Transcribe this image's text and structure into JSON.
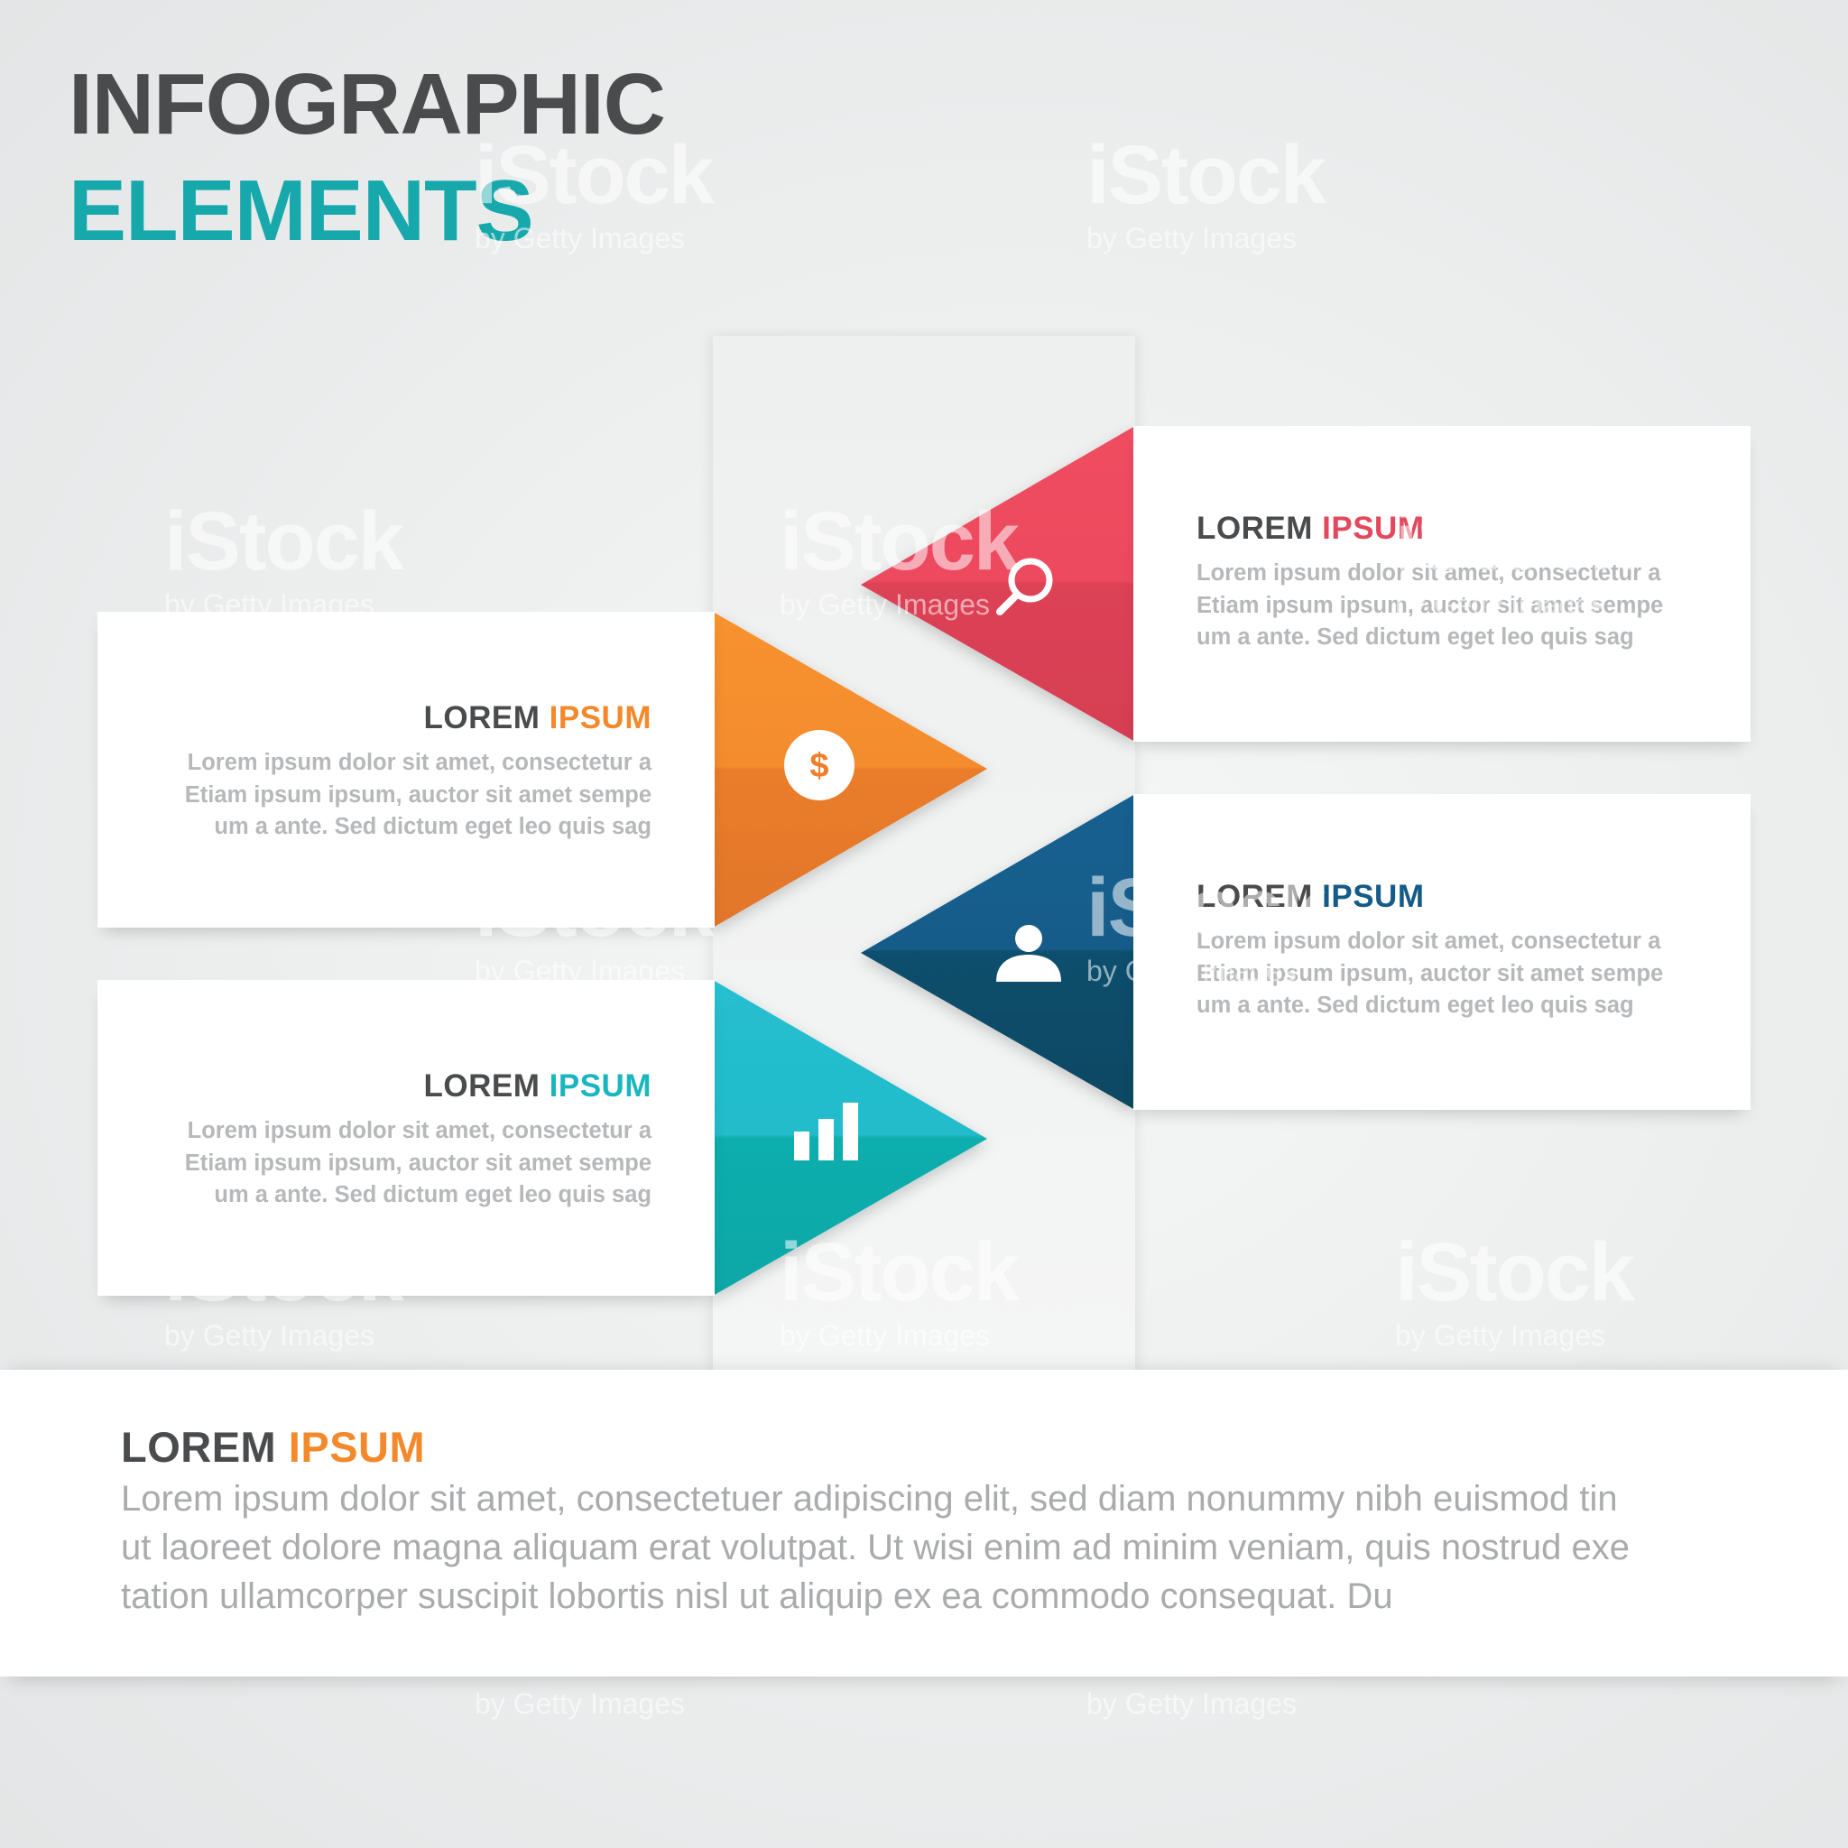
{
  "header": {
    "title_line1": "INFOGRAPHIC",
    "title_line2": "ELEMENTS",
    "title_accent_color": "#17a8ac"
  },
  "steps": [
    {
      "id": "red",
      "color": "#e4485c",
      "icon": "magnifier-icon",
      "title_dark": "LOREM",
      "title_accent": "IPSUM",
      "text": "Lorem ipsum dolor sit amet, consectetur a\nEtiam ipsum ipsum, auctor sit amet sempe\num a ante. Sed dictum eget leo quis sag"
    },
    {
      "id": "orange",
      "color": "#f3892b",
      "icon": "dollar-coin-icon",
      "title_dark": "LOREM",
      "title_accent": "IPSUM",
      "text": "Lorem ipsum dolor sit amet, consectetur a\nEtiam ipsum ipsum, auctor sit amet sempe\num a ante. Sed dictum eget leo quis sag"
    },
    {
      "id": "blue",
      "color": "#155b88",
      "icon": "user-icon",
      "title_dark": "LOREM",
      "title_accent": "IPSUM",
      "text": "Lorem ipsum dolor sit amet, consectetur a\nEtiam ipsum ipsum, auctor sit amet sempe\num a ante. Sed dictum eget leo quis sag"
    },
    {
      "id": "teal",
      "color": "#1ab6c0",
      "icon": "bar-chart-icon",
      "title_dark": "LOREM",
      "title_accent": "IPSUM",
      "text": "Lorem ipsum dolor sit amet, consectetur a\nEtiam ipsum ipsum, auctor sit amet sempe\num a ante. Sed dictum eget leo quis sag"
    }
  ],
  "bottom": {
    "title_dark": "LOREM",
    "title_accent": "IPSUM",
    "accent_color": "#f3892b",
    "text": "Lorem ipsum dolor sit amet, consectetuer adipiscing elit, sed diam nonummy nibh euismod tin\nut laoreet dolore magna aliquam erat volutpat. Ut wisi enim ad minim veniam, quis nostrud exe\ntation ullamcorper suscipit lobortis nisl ut aliquip ex ea commodo consequat. Du"
  },
  "watermark": {
    "brand": "iStock",
    "byline": "by Getty Images"
  }
}
